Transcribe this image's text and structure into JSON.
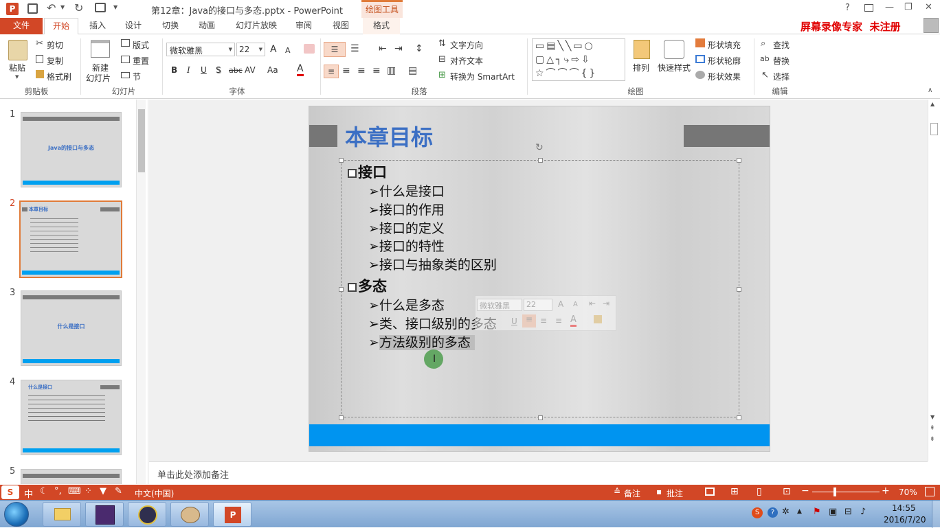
{
  "titlebar": {
    "title": "第12章：Java的接口与多态.pptx - PowerPoint",
    "contextual_group": "绘图工具",
    "help": "?",
    "min": "—",
    "max": "❐",
    "close": "✕"
  },
  "tabs": [
    "文件",
    "开始",
    "插入",
    "设计",
    "切换",
    "动画",
    "幻灯片放映",
    "审阅",
    "视图",
    "格式"
  ],
  "watermark": "屏幕录像专家  未注册",
  "ribbon": {
    "clipboard": {
      "paste": "粘贴",
      "cut": "剪切",
      "copy": "复制",
      "format_painter": "格式刷",
      "label": "剪贴板"
    },
    "slides": {
      "new_slide_1": "新建",
      "new_slide_2": "幻灯片",
      "layout": "版式",
      "reset": "重置",
      "section": "节",
      "label": "幻灯片"
    },
    "font": {
      "name": "微软雅黑",
      "size": "22",
      "bold": "B",
      "italic": "I",
      "underline": "U",
      "shadow": "S",
      "strike": "abc",
      "spacing": "AV",
      "case": "Aa",
      "color": "A",
      "grow": "A",
      "shrink": "A",
      "label": "字体"
    },
    "paragraph": {
      "text_direction": "文字方向",
      "align_text": "对齐文本",
      "smartart": "转换为 SmartArt",
      "label": "段落"
    },
    "drawing": {
      "arrange": "排列",
      "quick_styles": "快速样式",
      "shape_fill": "形状填充",
      "shape_outline": "形状轮廓",
      "shape_effects": "形状效果",
      "label": "绘图"
    },
    "editing": {
      "find": "查找",
      "replace": "替换",
      "select": "选择",
      "label": "编辑"
    }
  },
  "thumbnails": [
    {
      "num": "1",
      "title": "Java的接口与多态"
    },
    {
      "num": "2",
      "title": "本章目标"
    },
    {
      "num": "3",
      "title": "什么是接口"
    },
    {
      "num": "4",
      "title": "什么是接口"
    },
    {
      "num": "5",
      "title": ""
    }
  ],
  "slide": {
    "title": "本章目标",
    "items": [
      {
        "level": 1,
        "text": "接口"
      },
      {
        "level": 2,
        "text": "什么是接口"
      },
      {
        "level": 2,
        "text": "接口的作用"
      },
      {
        "level": 2,
        "text": "接口的定义"
      },
      {
        "level": 2,
        "text": "接口的特性"
      },
      {
        "level": 2,
        "text": "接口与抽象类的区别"
      },
      {
        "level": 1,
        "text": "多态"
      },
      {
        "level": 2,
        "text": "什么是多态"
      },
      {
        "level": 2,
        "text": "类、接口级别的多态"
      },
      {
        "level": 2,
        "text": "方法级别的多态"
      }
    ]
  },
  "minitoolbar": {
    "font": "微软雅黑",
    "size": "22"
  },
  "notes_placeholder": "单击此处添加备注",
  "status": {
    "language": "中文(中国)",
    "notes": "备注",
    "comments": "批注",
    "zoom": "70%"
  },
  "ime": {
    "mode": "中"
  },
  "clock": {
    "time": "14:55",
    "date": "2016/7/20"
  },
  "colors": {
    "accent": "#d24726",
    "slide_title": "#3b6fc4",
    "slide_blue_bar": "#0094f0"
  }
}
